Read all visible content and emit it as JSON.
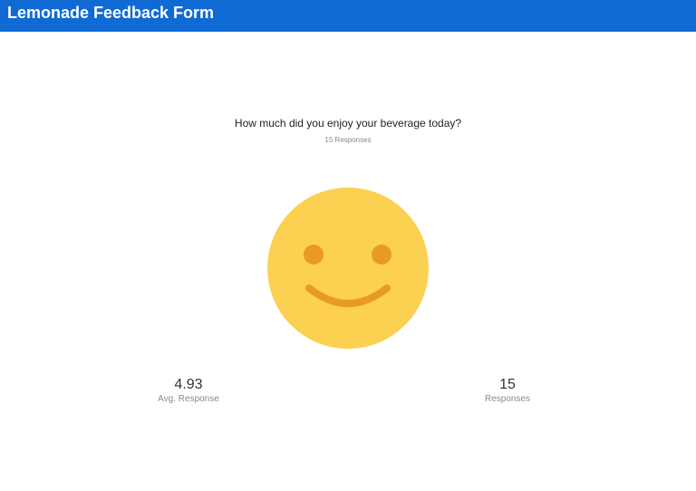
{
  "header": {
    "title": "Lemonade Feedback Form",
    "background_color": "#0f6ad4"
  },
  "question": {
    "text": "How much did you enjoy your beverage today?",
    "responses_label": "15 Responses"
  },
  "rating_icon": {
    "icon": "smiley-face-icon",
    "face_color": "#fcd050",
    "feature_color": "#e99a22"
  },
  "stats": {
    "average": {
      "value": "4.93",
      "label": "Avg. Response"
    },
    "count": {
      "value": "15",
      "label": "Responses"
    }
  }
}
